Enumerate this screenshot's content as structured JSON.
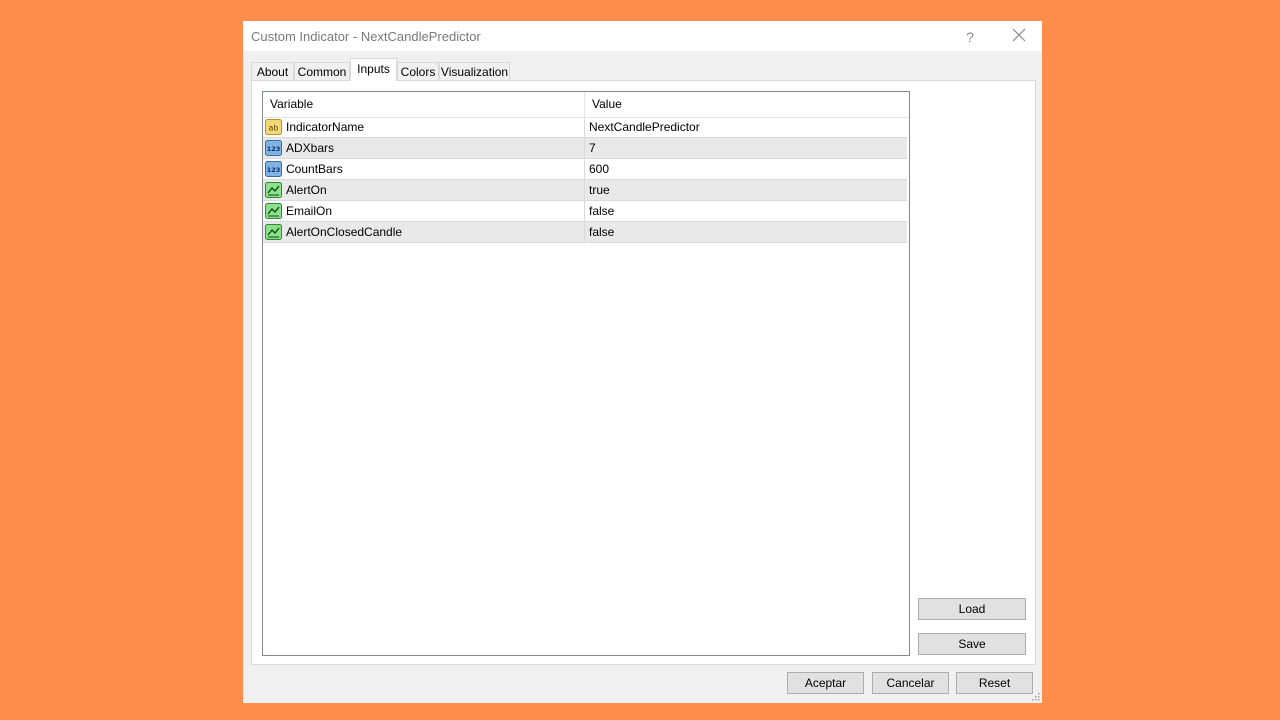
{
  "window": {
    "title": "Custom Indicator - NextCandlePredictor",
    "help_glyph": "?"
  },
  "tabs": [
    {
      "label": "About",
      "active": false
    },
    {
      "label": "Common",
      "active": false
    },
    {
      "label": "Inputs",
      "active": true
    },
    {
      "label": "Colors",
      "active": false
    },
    {
      "label": "Visualization",
      "active": false
    }
  ],
  "grid": {
    "headers": {
      "variable": "Variable",
      "value": "Value"
    },
    "rows": [
      {
        "icon": "string-type-icon",
        "variable": "IndicatorName",
        "value": "NextCandlePredictor"
      },
      {
        "icon": "integer-type-icon",
        "variable": "ADXbars",
        "value": "7"
      },
      {
        "icon": "integer-type-icon",
        "variable": "CountBars",
        "value": "600"
      },
      {
        "icon": "boolean-type-icon",
        "variable": "AlertOn",
        "value": "true"
      },
      {
        "icon": "boolean-type-icon",
        "variable": "EmailOn",
        "value": "false"
      },
      {
        "icon": "boolean-type-icon",
        "variable": "AlertOnClosedCandle",
        "value": "false"
      }
    ]
  },
  "side_buttons": {
    "load": "Load",
    "save": "Save"
  },
  "footer_buttons": {
    "ok": "Aceptar",
    "cancel": "Cancelar",
    "reset": "Reset"
  },
  "colors": {
    "background": "#FF8D4B",
    "dialog": "#F0F0F0",
    "row_alt": "#E9E9E9",
    "button": "#E1E1E1"
  }
}
